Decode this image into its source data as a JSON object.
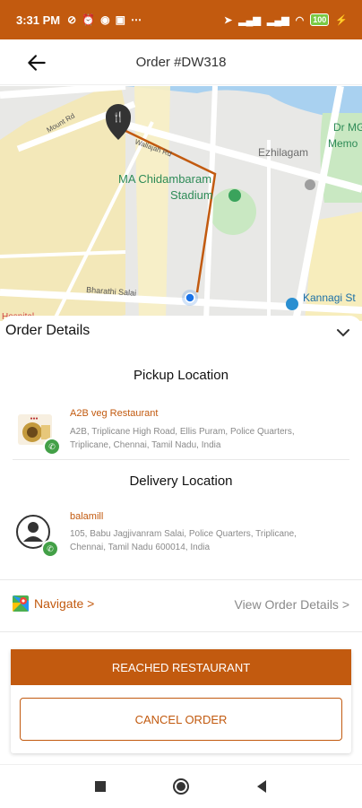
{
  "status_bar": {
    "time": "3:31 PM",
    "battery": "100",
    "left_icons": [
      "alarm-off-icon",
      "alarm-icon",
      "app-icon",
      "message-icon",
      "more-icon"
    ],
    "right_icons": [
      "location-icon",
      "signal-icon",
      "signal-icon",
      "wifi-icon",
      "battery-icon",
      "charging-icon"
    ]
  },
  "header": {
    "back_icon": "arrow-left-icon",
    "title": "Order #DW318"
  },
  "map": {
    "labels": {
      "mount_rd": "Mount Rd",
      "wallajah_rd": "Wallajah Rd",
      "ezhilagam": "Ezhilagam",
      "stadium_line1": "MA Chidambaram",
      "stadium_line2": "Stadium",
      "dr_mg_1": "Dr MG",
      "dr_mg_2": "Memo",
      "bharathi_salai": "Bharathi Salai",
      "kannagi": "Kannagi St",
      "hospital": "Hospital"
    },
    "route_color": "#c25a0f"
  },
  "sheet": {
    "title": "Order Details",
    "pickup": {
      "section_title": "Pickup Location",
      "name": "A2B veg Restaurant",
      "address_line1": "A2B, Triplicane High Road, Ellis Puram, Police Quarters,",
      "address_line2": "Triplicane, Chennai, Tamil Nadu, India"
    },
    "delivery": {
      "section_title": "Delivery Location",
      "name": "balamill",
      "address_line1": "105, Babu Jagjivanram Salai, Police Quarters, Triplicane,",
      "address_line2": "Chennai, Tamil Nadu 600014, India"
    },
    "navigate_label": "Navigate >",
    "view_order_label": "View Order Details >",
    "reached_button": "REACHED RESTAURANT",
    "cancel_button": "CANCEL ORDER"
  },
  "colors": {
    "accent": "#c25a0f",
    "call_badge": "#43a047"
  }
}
